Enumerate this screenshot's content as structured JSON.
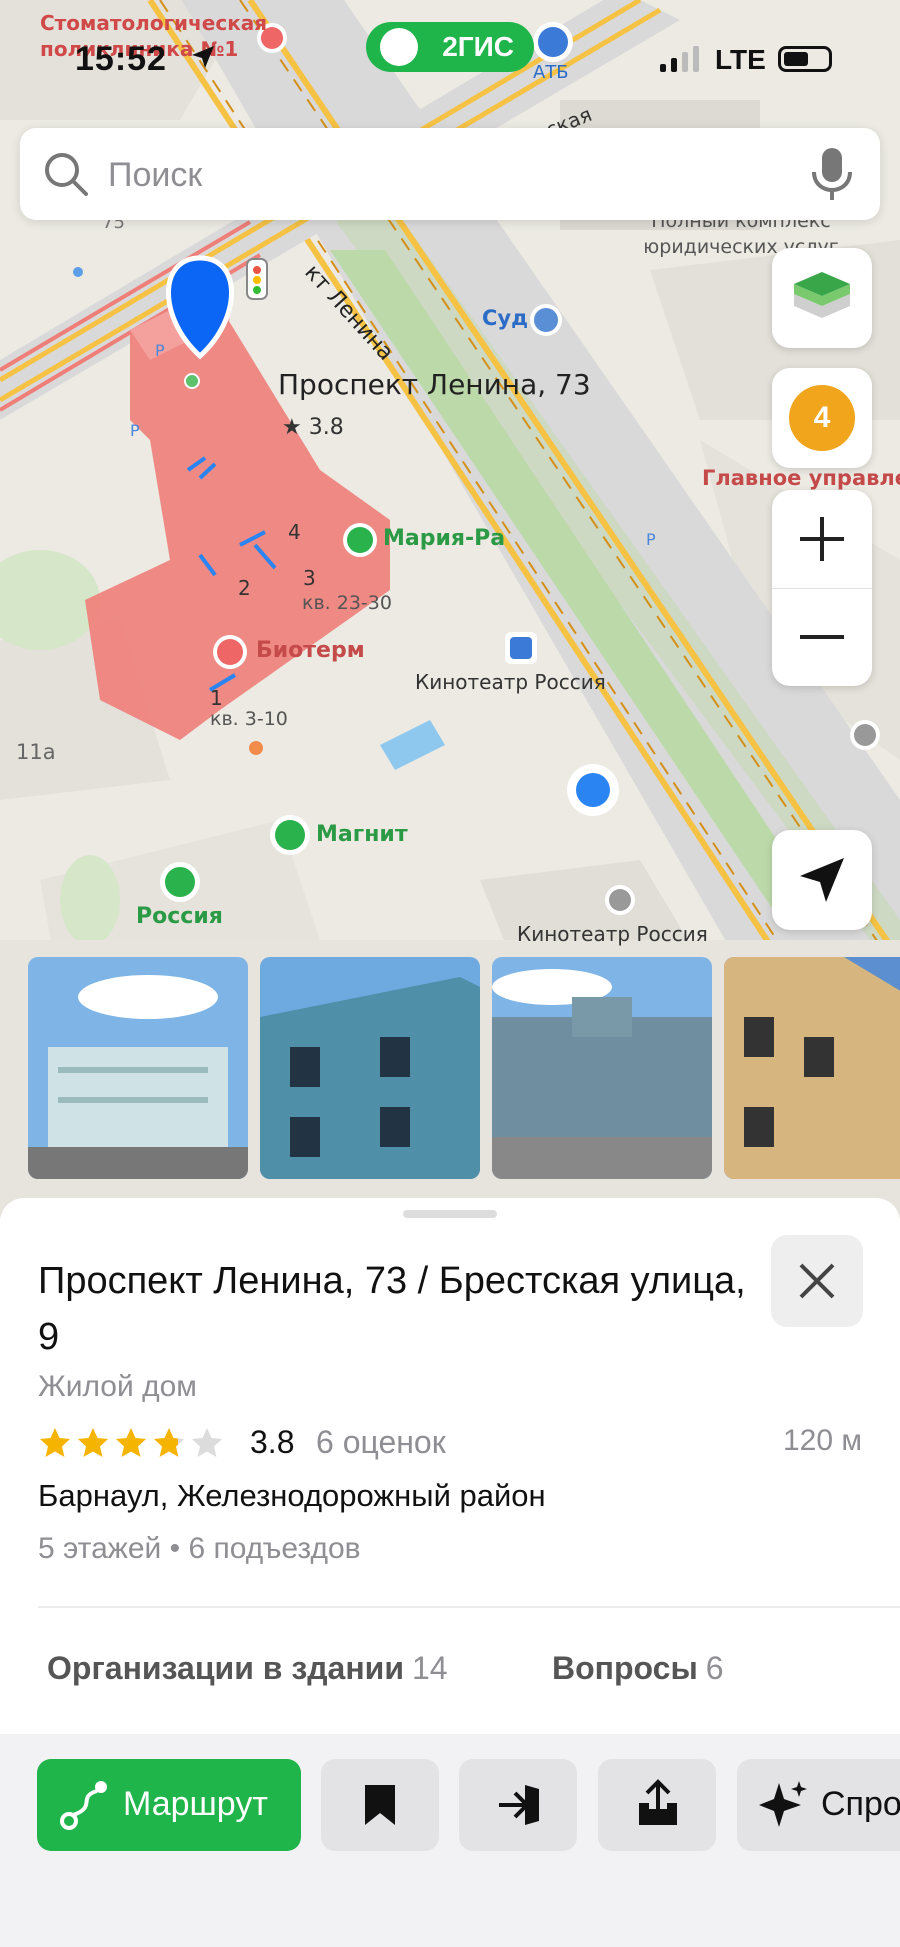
{
  "status_bar": {
    "time": "15:52",
    "network": "LTE",
    "brand": "2ГИС"
  },
  "search": {
    "placeholder": "Поиск"
  },
  "map": {
    "traffic_badge": "4",
    "labels": {
      "clinic": "Стоматологическая поликлиника №1",
      "atb": "АТБ",
      "street_vertical": "кт Ленина",
      "street_partial": "ская",
      "legal": "Полный комплекс юридических услуг",
      "court": "Суд",
      "address_pin": "Проспект Ленина, 73",
      "pin_rating": "★ 3.8",
      "main_admin": "Главное управле",
      "mariya_ra": "Мария-Ра",
      "entrance_4": "4",
      "entrance_2": "2",
      "entrance_3": "3",
      "entrance_1": "1",
      "apt_23_30": "кв. 23-30",
      "bioterm": "Биотерм",
      "apt_3_10": "кв. 3-10",
      "cinema_stop": "Кинотеатр Россия",
      "cinema": "Кинотеатр Россия",
      "house_11a": "11а",
      "house_75": "75",
      "magnit": "Магнит",
      "rossiya": "Россия"
    }
  },
  "place": {
    "title": "Проспект Ленина, 73 / Брестская улица, 9",
    "type": "Жилой дом",
    "rating": "3.8",
    "rating_value": 3.8,
    "reviews": "6 оценок",
    "distance": "120 м",
    "address": "Барнаул, Железнодорожный район",
    "meta": "5 этажей • 6 подъездов"
  },
  "tabs": [
    {
      "label": "Организации в здании",
      "count": "14"
    },
    {
      "label": "Вопросы",
      "count": "6"
    }
  ],
  "actions": {
    "route": "Маршрут",
    "ask": "Спро"
  },
  "colors": {
    "accent": "#1fb54b",
    "pin": "#0b66f5",
    "building": "#ef7e79",
    "road": "#f5c244",
    "star": "#f5b400"
  }
}
